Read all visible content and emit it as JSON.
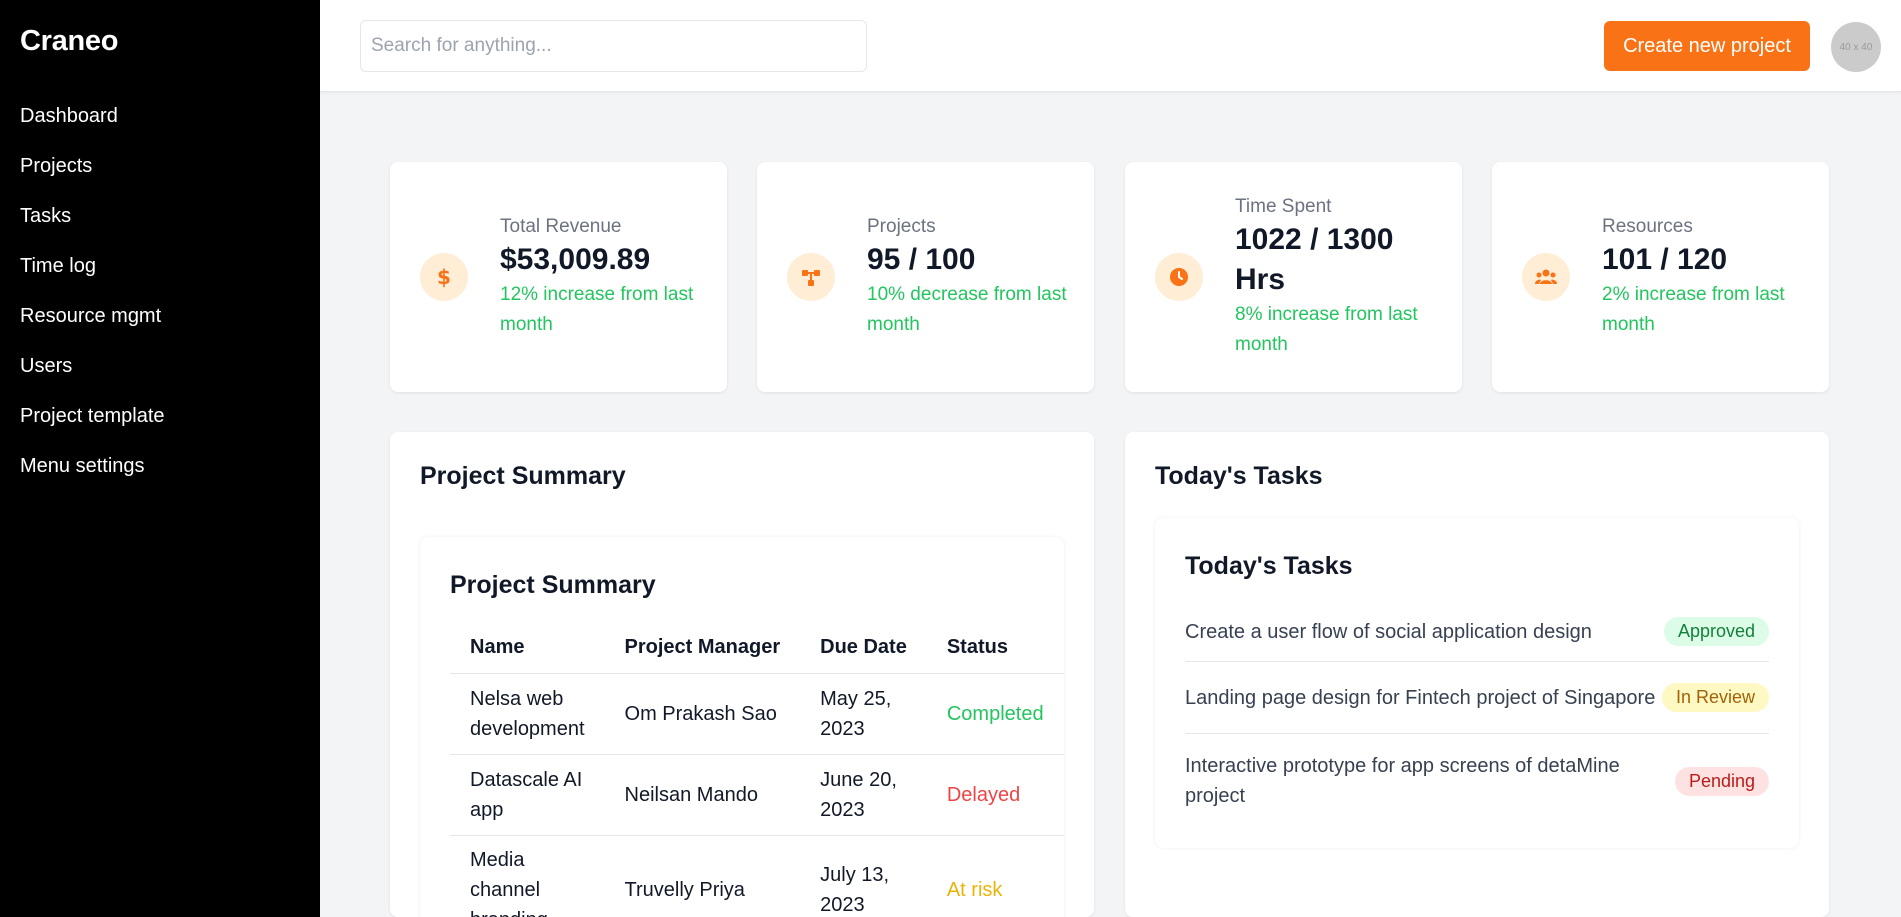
{
  "app": {
    "brand": "Craneo"
  },
  "sidebar": {
    "items": [
      {
        "label": "Dashboard"
      },
      {
        "label": "Projects"
      },
      {
        "label": "Tasks"
      },
      {
        "label": "Time log"
      },
      {
        "label": "Resource mgmt"
      },
      {
        "label": "Users"
      },
      {
        "label": "Project template"
      },
      {
        "label": "Menu settings"
      }
    ]
  },
  "header": {
    "search_placeholder": "Search for anything...",
    "create_button": "Create new project",
    "avatar_text": "40 x 40"
  },
  "stats": [
    {
      "icon": "dollar-icon",
      "label": "Total Revenue",
      "value": "$53,009.89",
      "change": "12% increase from last month"
    },
    {
      "icon": "project-flow-icon",
      "label": "Projects",
      "value": "95 / 100",
      "change": "10% decrease from last month"
    },
    {
      "icon": "clock-icon",
      "label": "Time Spent",
      "value": "1022 / 1300 Hrs",
      "change": "8% increase from last month"
    },
    {
      "icon": "users-icon",
      "label": "Resources",
      "value": "101 / 120",
      "change": "2% increase from last month"
    }
  ],
  "project_summary": {
    "title": "Project Summary",
    "inner_title": "Project Summary",
    "columns": [
      "Name",
      "Project Manager",
      "Due Date",
      "Status"
    ],
    "rows": [
      {
        "name": "Nelsa web development",
        "manager": "Om Prakash Sao",
        "due": "May 25, 2023",
        "status": "Completed"
      },
      {
        "name": "Datascale AI app",
        "manager": "Neilsan Mando",
        "due": "June 20, 2023",
        "status": "Delayed"
      },
      {
        "name": "Media channel branding",
        "manager": "Truvelly Priya",
        "due": "July 13, 2023",
        "status": "At risk"
      }
    ]
  },
  "todays_tasks": {
    "title": "Today's Tasks",
    "inner_title": "Today's Tasks",
    "items": [
      {
        "text": "Create a user flow of social application design",
        "status": "Approved"
      },
      {
        "text": "Landing page design for Fintech project of Singapore",
        "status": "In Review"
      },
      {
        "text": "Interactive prototype for app screens of detaMine project",
        "status": "Pending"
      }
    ]
  },
  "colors": {
    "accent": "#f97316",
    "icon_bg": "#ffedd5",
    "positive": "#22c55e",
    "negative": "#ef4444",
    "warning": "#eab308",
    "sidebar_bg": "#000000"
  }
}
